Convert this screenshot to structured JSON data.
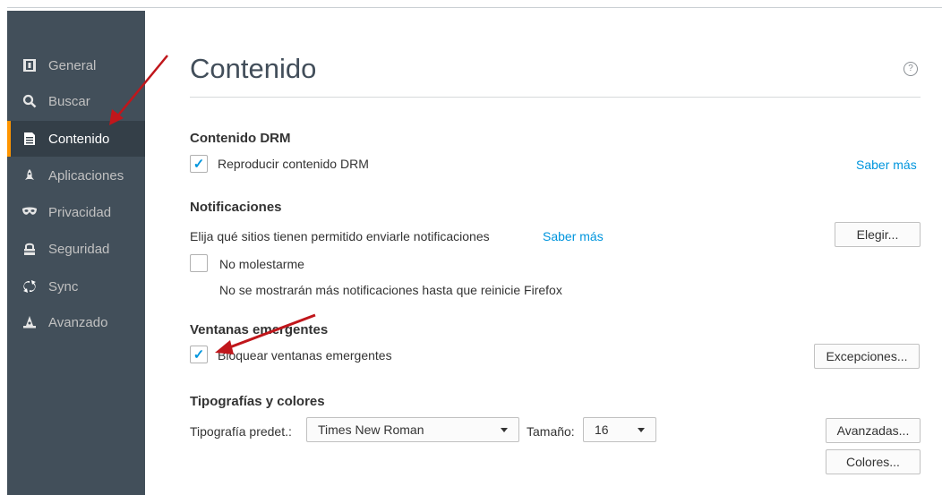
{
  "sidebar": {
    "items": [
      {
        "label": "General",
        "icon": "general-icon"
      },
      {
        "label": "Buscar",
        "icon": "search-icon"
      },
      {
        "label": "Contenido",
        "icon": "document-icon",
        "active": true
      },
      {
        "label": "Aplicaciones",
        "icon": "rocket-icon"
      },
      {
        "label": "Privacidad",
        "icon": "mask-icon"
      },
      {
        "label": "Seguridad",
        "icon": "lock-icon"
      },
      {
        "label": "Sync",
        "icon": "sync-icon"
      },
      {
        "label": "Avanzado",
        "icon": "wizard-hat-icon"
      }
    ]
  },
  "main": {
    "title": "Contenido",
    "help_icon": "?",
    "drm": {
      "title": "Contenido DRM",
      "checkbox_label": "Reproducir contenido DRM",
      "checked": true,
      "learn_more": "Saber más"
    },
    "notifications": {
      "title": "Notificaciones",
      "description": "Elija qué sitios tienen permitido enviarle notificaciones",
      "learn_more": "Saber más",
      "choose_button": "Elegir...",
      "dnd_label": "No molestarme",
      "dnd_checked": false,
      "dnd_note": "No se mostrarán más notificaciones hasta que reinicie Firefox"
    },
    "popups": {
      "title": "Ventanas emergentes",
      "block_label": "Bloquear ventanas emergentes",
      "block_checked": true,
      "exceptions_button": "Excepciones..."
    },
    "fonts": {
      "title": "Tipografías y colores",
      "default_font_label": "Tipografía predet.:",
      "default_font_value": "Times New Roman",
      "size_label": "Tamaño:",
      "size_value": "16",
      "advanced_button": "Avanzadas...",
      "colors_button": "Colores..."
    }
  },
  "colors": {
    "sidebar_bg": "#424f5a",
    "sidebar_active_bg": "#343f48",
    "accent": "#ff9500",
    "link": "#0095dd",
    "annotation_arrow": "#c0161b"
  }
}
